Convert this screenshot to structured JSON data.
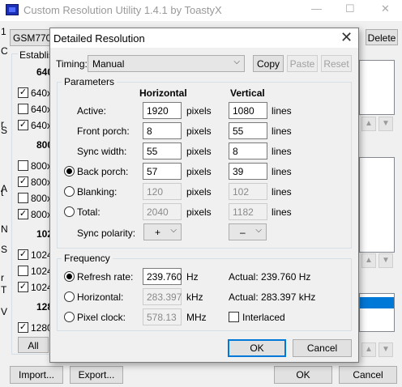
{
  "app": {
    "title": "Custom Resolution Utility 1.4.1 by ToastyX",
    "minimize": "—",
    "maximize": "☐",
    "close": "✕"
  },
  "main": {
    "monitor_value": "GSM770F",
    "delete_label": "Delete",
    "established_label": "Establish",
    "res_640_header": "640",
    "res_800_header": "800",
    "res_1024_header": "102",
    "res_1280_header": "128",
    "res_items": [
      {
        "label": "640x",
        "checked": true
      },
      {
        "label": "640x",
        "checked": false
      },
      {
        "label": "640x",
        "checked": true
      },
      {
        "label": "800x",
        "checked": false
      },
      {
        "label": "800x",
        "checked": true
      },
      {
        "label": "800x",
        "checked": false
      },
      {
        "label": "800x",
        "checked": true
      },
      {
        "label": "1024",
        "checked": true
      },
      {
        "label": "1024",
        "checked": false
      },
      {
        "label": "1024",
        "checked": true
      },
      {
        "label": "1280",
        "checked": true
      }
    ],
    "all_label": "All",
    "import_label": "Import...",
    "export_label": "Export...",
    "ok_label": "OK",
    "cancel_label": "Cancel",
    "left_edge_chars": [
      "1",
      "C",
      "r",
      "S",
      "A",
      "t",
      "N",
      "S",
      "r",
      "T",
      "V"
    ]
  },
  "dialog": {
    "title": "Detailed Resolution",
    "close": "✕",
    "timing_label": "Timing:",
    "timing_value": "Manual",
    "copy_label": "Copy",
    "paste_label": "Paste",
    "reset_label": "Reset",
    "parameters_title": "Parameters",
    "horizontal_header": "Horizontal",
    "vertical_header": "Vertical",
    "rows": [
      {
        "label": "Active:",
        "h": "1920",
        "h_unit": "pixels",
        "v": "1080",
        "v_unit": "lines"
      },
      {
        "label": "Front porch:",
        "h": "8",
        "h_unit": "pixels",
        "v": "55",
        "v_unit": "lines"
      },
      {
        "label": "Sync width:",
        "h": "55",
        "h_unit": "pixels",
        "v": "8",
        "v_unit": "lines"
      },
      {
        "label": "Back porch:",
        "h": "57",
        "h_unit": "pixels",
        "v": "39",
        "v_unit": "lines"
      },
      {
        "label": "Blanking:",
        "h": "120",
        "h_unit": "pixels",
        "v": "102",
        "v_unit": "lines"
      },
      {
        "label": "Total:",
        "h": "2040",
        "h_unit": "pixels",
        "v": "1182",
        "v_unit": "lines"
      }
    ],
    "sync_polarity_label": "Sync polarity:",
    "h_polarity": "+",
    "v_polarity": "–",
    "frequency_title": "Frequency",
    "refresh_label": "Refresh rate:",
    "refresh_value": "239.760",
    "refresh_unit": "Hz",
    "refresh_actual": "Actual: 239.760 Hz",
    "horizontal_label": "Horizontal:",
    "horizontal_value": "283.397",
    "horizontal_unit": "kHz",
    "horizontal_actual": "Actual: 283.397 kHz",
    "pixel_clock_label": "Pixel clock:",
    "pixel_clock_value": "578.13",
    "pixel_clock_unit": "MHz",
    "interlaced_label": "Interlaced",
    "ok_label": "OK",
    "cancel_label": "Cancel"
  },
  "colors": {
    "accent": "#0078d7",
    "selection": "#0078d7"
  }
}
